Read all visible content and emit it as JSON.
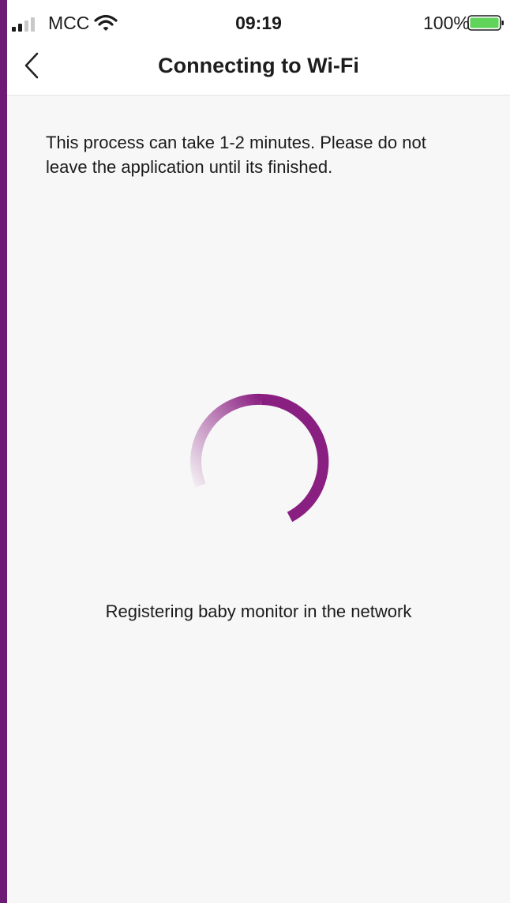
{
  "status_bar": {
    "carrier": "MCC",
    "time": "09:19",
    "battery_percent": "100%",
    "battery_level": 1.0,
    "icons": {
      "signal": "cellular-signal-icon",
      "wifi": "wifi-icon",
      "battery": "battery-icon"
    }
  },
  "nav": {
    "title": "Connecting to Wi-Fi",
    "back_icon": "chevron-left-icon"
  },
  "content": {
    "info": "This process can take 1-2 minutes. Please do not leave the application until its finished.",
    "status": "Registering baby monitor in the network",
    "spinner_icon": "loading-spinner-icon"
  },
  "colors": {
    "accent": "#8a1f82",
    "background": "#f7f7f7",
    "frame": "#6d1b73",
    "battery": "#5fd35a"
  }
}
